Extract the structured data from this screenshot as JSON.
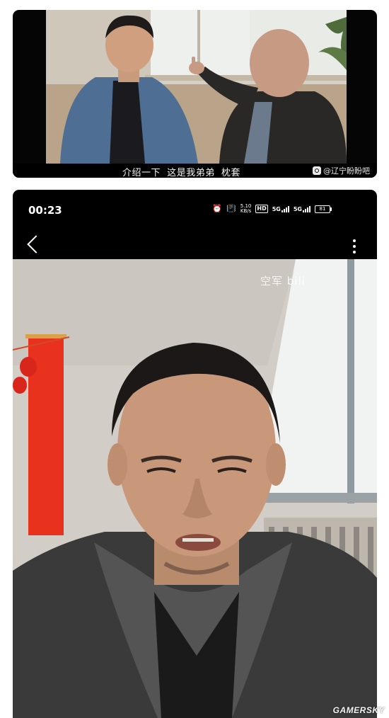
{
  "top_video": {
    "subtitle": "介绍一下  这是我弟弟  枕套",
    "watermark_icon": "weibo-icon",
    "watermark": "@辽宁盼盼吧"
  },
  "phone": {
    "status_bar": {
      "time": "00:23",
      "alarm_icon": "alarm-clock-icon",
      "vibrate_icon": "vibrate-icon",
      "net_speed_value": "5.10",
      "net_speed_unit": "KB/s",
      "hd_badge": "HD",
      "sim1": "5G",
      "sim2": "5G",
      "battery": "81"
    },
    "nav": {
      "back_icon": "chevron-left-icon",
      "more_icon": "more-vertical-icon"
    },
    "video": {
      "watermark": "空军 bili"
    }
  },
  "site_watermark": "GAMERSKY"
}
